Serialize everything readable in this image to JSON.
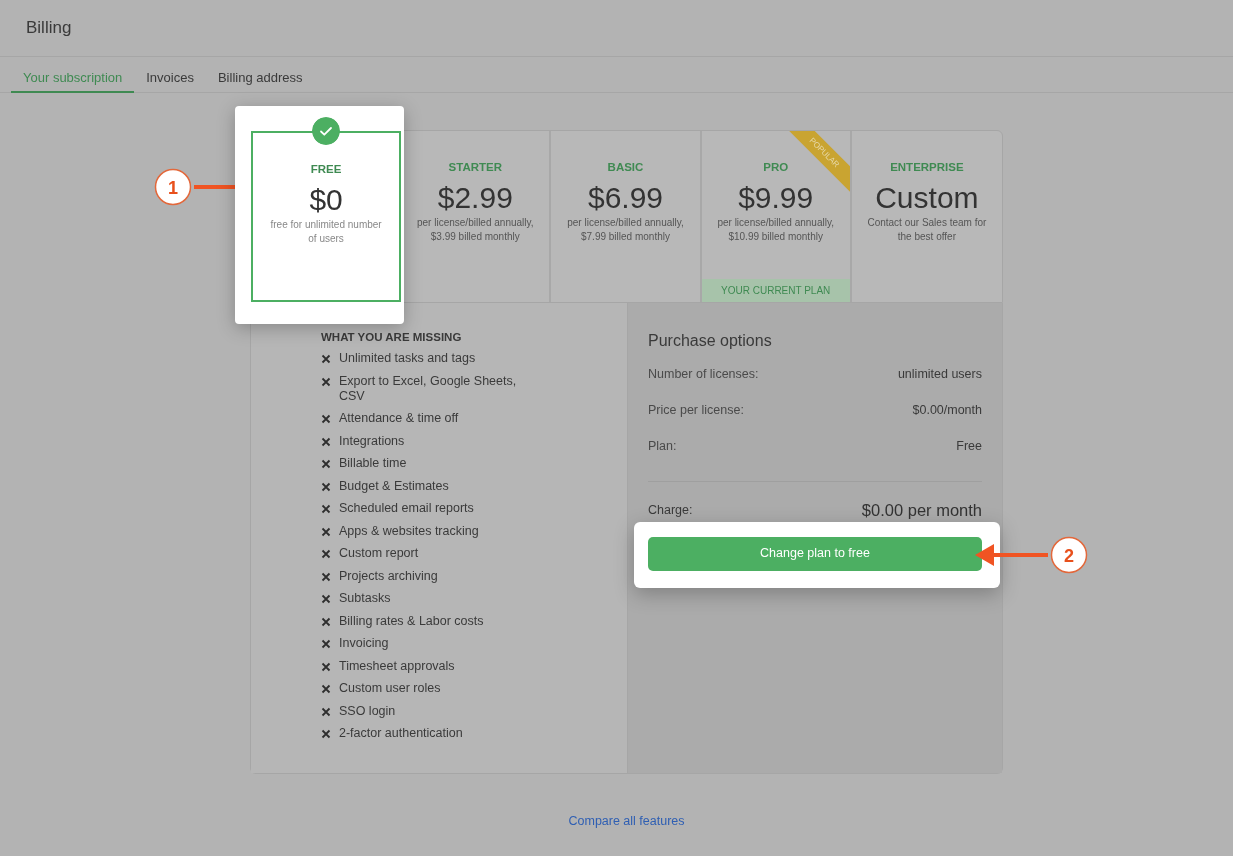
{
  "header": {
    "title": "Billing"
  },
  "tabs": [
    {
      "label": "Your subscription",
      "selected": true
    },
    {
      "label": "Invoices",
      "selected": false
    },
    {
      "label": "Billing address",
      "selected": false
    }
  ],
  "plans": [
    {
      "name": "FREE",
      "price": "$0",
      "description": "free for unlimited number of users",
      "selected": true
    },
    {
      "name": "STARTER",
      "price": "$2.99",
      "description": "per license/billed annually, $3.99 billed monthly",
      "selected": false
    },
    {
      "name": "BASIC",
      "price": "$6.99",
      "description": "per license/billed annually, $7.99 billed monthly",
      "selected": false
    },
    {
      "name": "PRO",
      "price": "$9.99",
      "description": "per license/billed annually, $10.99 billed monthly",
      "selected": false,
      "ribbon": "POPULAR",
      "footer": "YOUR CURRENT PLAN"
    },
    {
      "name": "ENTERPRISE",
      "price": "Custom",
      "description": "Contact our Sales team for the best offer",
      "selected": false
    }
  ],
  "missing": {
    "title": "WHAT YOU ARE MISSING",
    "items": [
      "Unlimited tasks and tags",
      "Export to Excel, Google Sheets, CSV",
      "Attendance & time off",
      "Integrations",
      "Billable time",
      "Budget & Estimates",
      "Scheduled email reports",
      "Apps & websites tracking",
      "Custom report",
      "Projects archiving",
      "Subtasks",
      "Billing rates & Labor costs",
      "Invoicing",
      "Timesheet approvals",
      "Custom user roles",
      "SSO login",
      "2-factor authentication"
    ]
  },
  "purchase": {
    "title": "Purchase options",
    "rows": [
      {
        "label": "Number of licenses:",
        "value": "unlimited users"
      },
      {
        "label": "Price per license:",
        "value": "$0.00/month"
      },
      {
        "label": "Plan:",
        "value": "Free"
      }
    ],
    "charge_label": "Charge:",
    "charge_value": "$0.00 per month",
    "button": "Change plan to free"
  },
  "compare_link": "Compare all features",
  "annotations": [
    {
      "label": "1"
    },
    {
      "label": "2"
    }
  ]
}
